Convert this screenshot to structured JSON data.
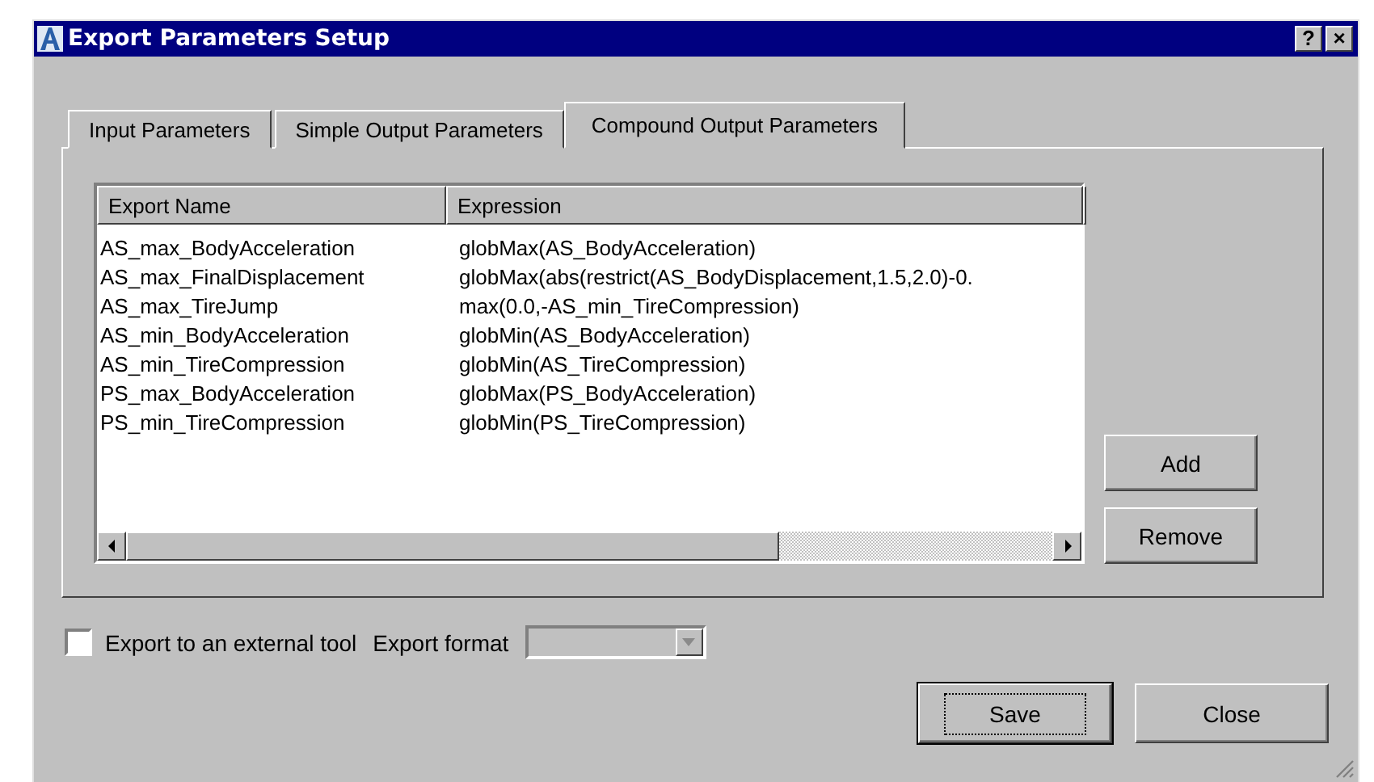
{
  "window": {
    "title": "Export Parameters Setup",
    "buttons": [
      "?",
      "×"
    ]
  },
  "tabs": [
    {
      "label": "Input Parameters",
      "selected": false
    },
    {
      "label": "Simple Output Parameters",
      "selected": false
    },
    {
      "label": "Compound Output Parameters",
      "selected": true
    }
  ],
  "table": {
    "columns": [
      "Export Name",
      "Expression"
    ],
    "rows": [
      [
        "AS_max_BodyAcceleration",
        "globMax(AS_BodyAcceleration)"
      ],
      [
        "AS_max_FinalDisplacement",
        "globMax(abs(restrict(AS_BodyDisplacement,1.5,2.0)-0."
      ],
      [
        "AS_max_TireJump",
        "max(0.0,-AS_min_TireCompression)"
      ],
      [
        "AS_min_BodyAcceleration",
        "globMin(AS_BodyAcceleration)"
      ],
      [
        "AS_min_TireCompression",
        "globMin(AS_TireCompression)"
      ],
      [
        "PS_max_BodyAcceleration",
        "globMax(PS_BodyAcceleration)"
      ],
      [
        "PS_min_TireCompression",
        "globMin(PS_TireCompression)"
      ]
    ]
  },
  "side_buttons": [
    "Add",
    "Remove"
  ],
  "export_external": {
    "label": "Export to an external tool",
    "checked": false
  },
  "export_format": {
    "label": "Export format",
    "disabled": true
  },
  "buttons": [
    {
      "label": "Save",
      "default": true
    },
    {
      "label": "Close",
      "default": false
    }
  ]
}
